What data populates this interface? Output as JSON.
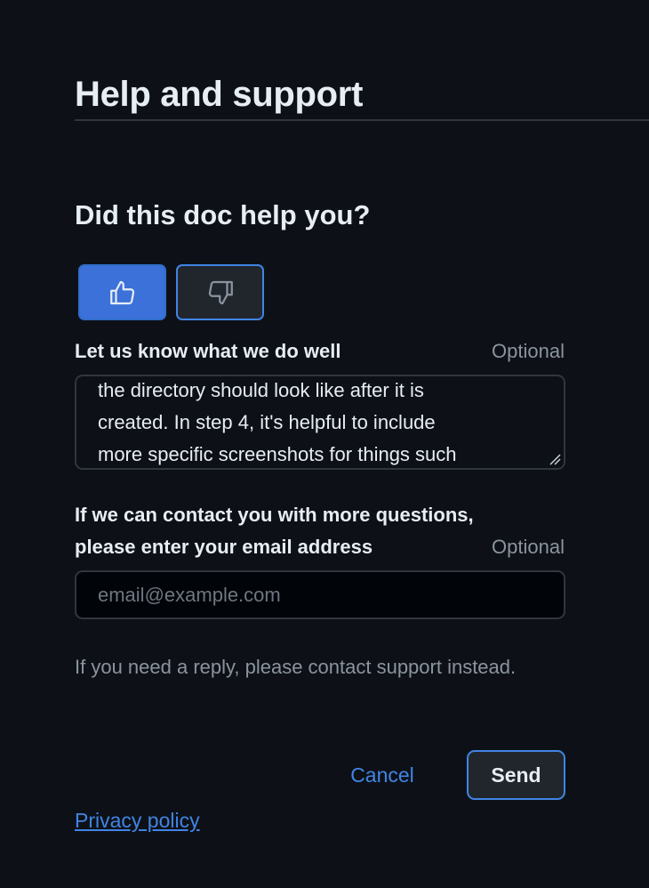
{
  "header": {
    "title": "Help and support"
  },
  "feedback": {
    "question": "Did this doc help you?",
    "thumbs_up_icon": "thumbs-up-icon",
    "thumbs_down_icon": "thumbs-down-icon",
    "selected": "thumbs-up"
  },
  "comment": {
    "label": "Let us know what we do well",
    "optional": "Optional",
    "value": "the directory should look like after it is\ncreated. In step 4, it's helpful to include\nmore specific screenshots for things such"
  },
  "email": {
    "label_line1": "If we can contact you with more questions,",
    "label_line2": "please enter your email address",
    "optional": "Optional",
    "placeholder": "email@example.com",
    "value": ""
  },
  "reply_note": "If you need a reply, please contact support instead.",
  "actions": {
    "cancel_label": "Cancel",
    "send_label": "Send"
  },
  "footer": {
    "privacy_label": "Privacy policy"
  },
  "colors": {
    "background": "#0d1117",
    "accent": "#4184e4",
    "selected_button": "#3c71d9",
    "muted_text": "#8b949e"
  }
}
